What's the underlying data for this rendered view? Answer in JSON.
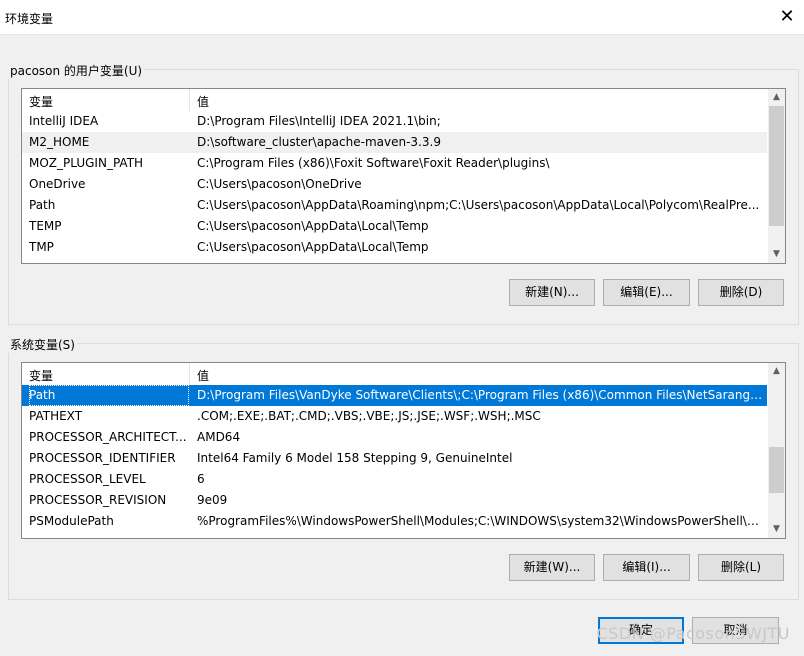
{
  "window": {
    "title": "环境变量",
    "close_glyph": "✕"
  },
  "user_vars": {
    "group_label": "pacoson 的用户变量(U)",
    "col_var": "变量",
    "col_val": "值",
    "rows": [
      {
        "name": "IntelliJ IDEA",
        "value": "D:\\Program Files\\IntelliJ IDEA 2021.1\\bin;"
      },
      {
        "name": "M2_HOME",
        "value": "D:\\software_cluster\\apache-maven-3.3.9"
      },
      {
        "name": "MOZ_PLUGIN_PATH",
        "value": "C:\\Program Files (x86)\\Foxit Software\\Foxit Reader\\plugins\\"
      },
      {
        "name": "OneDrive",
        "value": "C:\\Users\\pacoson\\OneDrive"
      },
      {
        "name": "Path",
        "value": "C:\\Users\\pacoson\\AppData\\Roaming\\npm;C:\\Users\\pacoson\\AppData\\Local\\Polycom\\RealPre..."
      },
      {
        "name": "TEMP",
        "value": "C:\\Users\\pacoson\\AppData\\Local\\Temp"
      },
      {
        "name": "TMP",
        "value": "C:\\Users\\pacoson\\AppData\\Local\\Temp"
      }
    ],
    "hover_row": 1,
    "buttons": {
      "new": "新建(N)...",
      "edit": "编辑(E)...",
      "delete": "删除(D)"
    }
  },
  "system_vars": {
    "group_label": "系统变量(S)",
    "col_var": "变量",
    "col_val": "值",
    "rows": [
      {
        "name": "Path",
        "value": "D:\\Program Files\\VanDyke Software\\Clients\\;C:\\Program Files (x86)\\Common Files\\NetSarang;C..."
      },
      {
        "name": "PATHEXT",
        "value": ".COM;.EXE;.BAT;.CMD;.VBS;.VBE;.JS;.JSE;.WSF;.WSH;.MSC"
      },
      {
        "name": "PROCESSOR_ARCHITECT...",
        "value": "AMD64"
      },
      {
        "name": "PROCESSOR_IDENTIFIER",
        "value": "Intel64 Family 6 Model 158 Stepping 9, GenuineIntel"
      },
      {
        "name": "PROCESSOR_LEVEL",
        "value": "6"
      },
      {
        "name": "PROCESSOR_REVISION",
        "value": "9e09"
      },
      {
        "name": "PSModulePath",
        "value": "%ProgramFiles%\\WindowsPowerShell\\Modules;C:\\WINDOWS\\system32\\WindowsPowerShell\\v..."
      }
    ],
    "selected_row": 0,
    "buttons": {
      "new": "新建(W)...",
      "edit": "编辑(I)...",
      "delete": "删除(L)"
    }
  },
  "footer": {
    "ok": "确定",
    "cancel": "取消"
  },
  "watermark": "CSDN @PacosonSWJTU",
  "colors": {
    "selection": "#0078d7",
    "default_button_border": "#0078d7"
  }
}
